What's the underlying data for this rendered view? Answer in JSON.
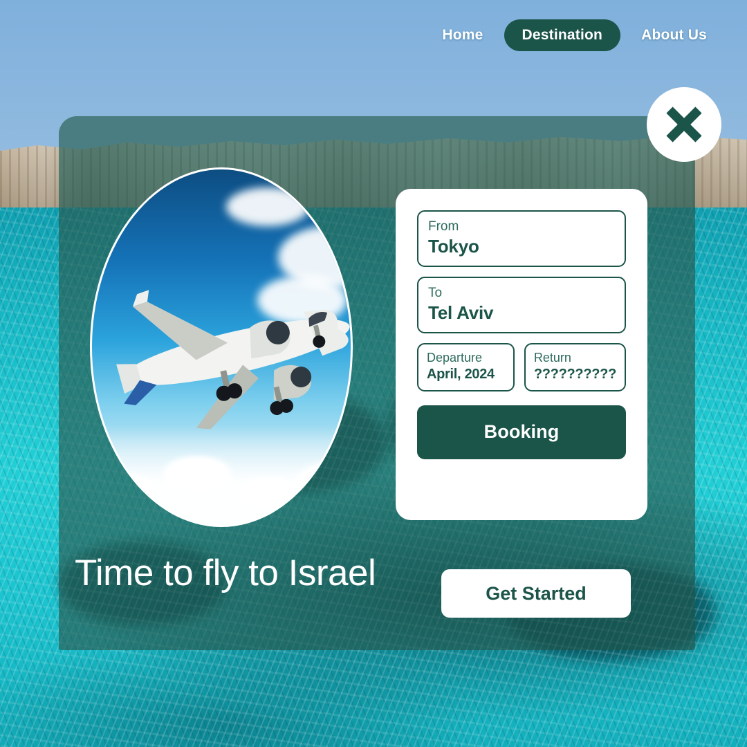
{
  "nav": {
    "items": [
      {
        "label": "Home",
        "active": false
      },
      {
        "label": "Destination",
        "active": true
      },
      {
        "label": "About Us",
        "active": false
      }
    ]
  },
  "close": {
    "icon": "close-icon"
  },
  "booking_card": {
    "from": {
      "label": "From",
      "value": "Tokyo"
    },
    "to": {
      "label": "To",
      "value": "Tel Aviv"
    },
    "departure": {
      "label": "Departure",
      "value": "April, 2024"
    },
    "return": {
      "label": "Return",
      "value": "??????????"
    },
    "submit_label": "Booking"
  },
  "hero": {
    "headline": "Time to fly to Israel",
    "cta_label": "Get Started",
    "image_alt": "airplane-photo"
  },
  "colors": {
    "brand_green": "#1b5448",
    "panel_overlay": "rgba(20,86,76,.60)",
    "white": "#ffffff",
    "water_turquoise": "#22cfd6",
    "sky_blue": "#8ab6de"
  }
}
